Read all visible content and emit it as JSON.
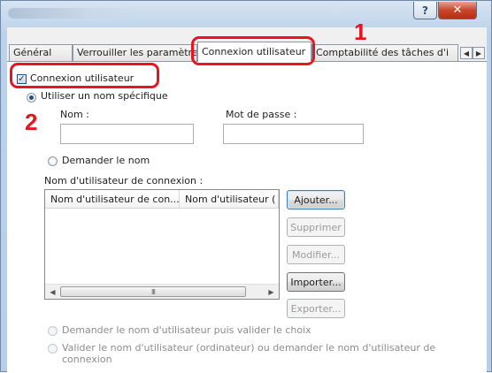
{
  "window": {
    "help_glyph": "?",
    "close_glyph": "✕"
  },
  "tabs": [
    {
      "label": "Général"
    },
    {
      "label": "Verrouiller les paramètres"
    },
    {
      "label": "Connexion utilisateur",
      "active": true
    },
    {
      "label": "Comptabilité des tâches d'i"
    }
  ],
  "tab_scroll": {
    "left": "◀",
    "right": "▶"
  },
  "login": {
    "enable_checkbox": {
      "label": "Connexion utilisateur",
      "checked": true
    },
    "specific_name_radio": {
      "label": "Utiliser un nom spécifique",
      "selected": true
    },
    "name_label": "Nom :",
    "name_value": "",
    "password_label": "Mot de passe :",
    "password_value": "",
    "prompt_radio": {
      "label": "Demander le nom",
      "selected": false
    },
    "list_label": "Nom d'utilisateur de connexion :",
    "columns": [
      "Nom d'utilisateur de con...",
      "Nom d'utilisateur ("
    ],
    "scroll_thumb": "III",
    "buttons": {
      "add": "Ajouter...",
      "delete": "Supprimer",
      "modify": "Modifier...",
      "import": "Importer...",
      "export": "Exporter..."
    },
    "validate_radio": {
      "label": "Demander le nom d'utilisateur puis valider le choix"
    },
    "validate_pc_radio": {
      "line1": "Valider le nom d'utilisateur (ordinateur) ou demander le nom d'utilisateur de",
      "line2": "connexion"
    }
  },
  "callouts": {
    "one": "1",
    "two": "2"
  },
  "colors": {
    "callout": "#e8141f",
    "accent": "#1d5288"
  }
}
